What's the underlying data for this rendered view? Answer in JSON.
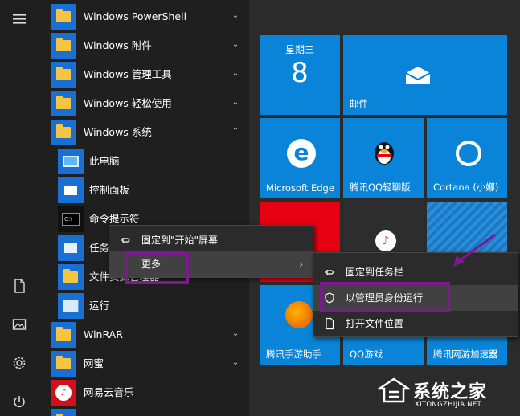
{
  "rail": {
    "menu_icon": "hamburger-icon",
    "document_icon": "document-icon",
    "pictures_icon": "pictures-icon",
    "settings_icon": "gear-icon",
    "power_icon": "power-icon"
  },
  "apps": [
    {
      "label": "Windows PowerShell",
      "type": "folder",
      "expanded": false
    },
    {
      "label": "Windows 附件",
      "type": "folder",
      "expanded": false
    },
    {
      "label": "Windows 管理工具",
      "type": "folder",
      "expanded": false
    },
    {
      "label": "Windows 轻松使用",
      "type": "folder",
      "expanded": false
    },
    {
      "label": "Windows 系统",
      "type": "folder",
      "expanded": true
    },
    {
      "label": "此电脑",
      "type": "app"
    },
    {
      "label": "控制面板",
      "type": "app"
    },
    {
      "label": "命令提示符",
      "type": "app"
    },
    {
      "label": "任务管理器",
      "type": "app"
    },
    {
      "label": "文件资源管理器",
      "type": "app"
    },
    {
      "label": "运行",
      "type": "app"
    },
    {
      "label": "WinRAR",
      "type": "folder",
      "expanded": false
    },
    {
      "label": "网蜜",
      "type": "folder",
      "expanded": false
    },
    {
      "label": "网易云音乐",
      "type": "app"
    }
  ],
  "tiles": {
    "calendar_day": "星期三",
    "calendar_date": "8",
    "mail": "邮件",
    "edge": "Microsoft Edge",
    "qq": "腾讯QQ轻聊版",
    "cortana": "Cortana (小娜)",
    "tencent_mobile_games": "腾讯手游助手",
    "qq_game": "QQ游戏",
    "tencent_accelerator": "腾讯网游加速器"
  },
  "context_menu": {
    "pin_start": "固定到\"开始\"屏幕",
    "more": "更多"
  },
  "submenu": {
    "pin_taskbar": "固定到任务栏",
    "run_as_admin": "以管理员身份运行",
    "open_location": "打开文件位置"
  },
  "watermark": {
    "title": "系统之家",
    "url": "XITONGZHIJIA.NET"
  },
  "colors": {
    "accent": "#0a84d8",
    "highlight": "#7b1a8c",
    "menu_bg": "#2b2b2b"
  }
}
